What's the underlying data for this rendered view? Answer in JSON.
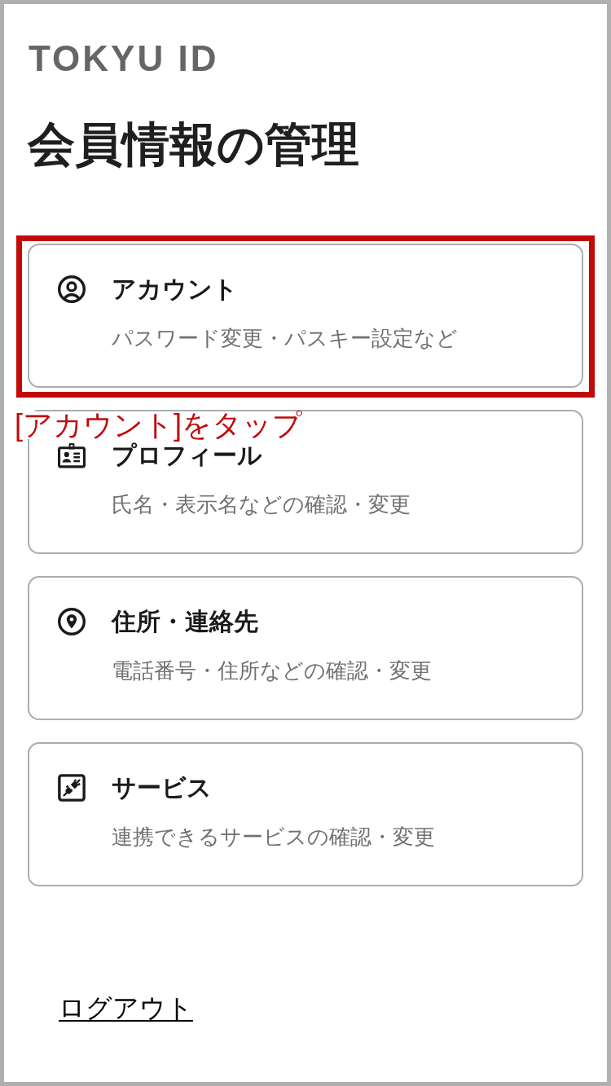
{
  "logo": "TOKYU ID",
  "title": "会員情報の管理",
  "items": [
    {
      "kind": "account",
      "label": "アカウント",
      "description": "パスワード変更・パスキー設定など",
      "highlighted": true
    },
    {
      "kind": "profile",
      "label": "プロフィール",
      "description": "氏名・表示名などの確認・変更",
      "highlighted": false
    },
    {
      "kind": "address",
      "label": "住所・連絡先",
      "description": "電話番号・住所などの確認・変更",
      "highlighted": false
    },
    {
      "kind": "service",
      "label": "サービス",
      "description": "連携できるサービスの確認・変更",
      "highlighted": false
    }
  ],
  "callout": "[アカウント]をタップ",
  "logout": "ログアウト"
}
